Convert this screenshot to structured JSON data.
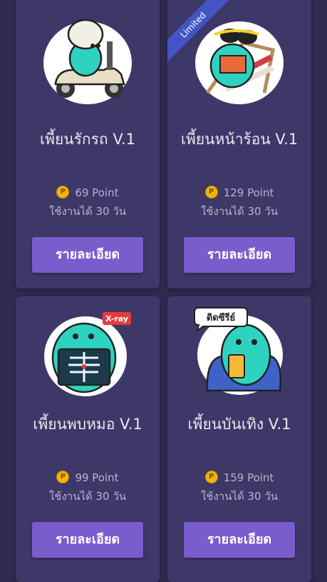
{
  "cards": [
    {
      "name": "เพี้ยนรักรถ V.1",
      "price": "69 Point",
      "duration": "ใช้งานได้ 30 วัน",
      "button_label": "รายละเอียด",
      "sticker_icon": "scooter-dino-sticker-icon"
    },
    {
      "name": "เพี้ยนหน้าร้อน V.1",
      "price": "129 Point",
      "duration": "ใช้งานได้ 30 วัน",
      "button_label": "รายละเอียด",
      "badge": "Limited",
      "sticker_icon": "beach-chair-dino-sticker-icon"
    },
    {
      "name": "เพี้ยนพบหมอ V.1",
      "price": "99 Point",
      "duration": "ใช้งานได้ 30 วัน",
      "button_label": "รายละเอียด",
      "sticker_label": "X-ray",
      "sticker_icon": "xray-dino-sticker-icon"
    },
    {
      "name": "เพี้ยนบันเทิง V.1",
      "price": "159 Point",
      "duration": "ใช้งานได้ 30 วัน",
      "button_label": "รายละเอียด",
      "sticker_label": "ติดซีรีย์",
      "sticker_icon": "phone-dino-sticker-icon"
    }
  ],
  "coin_symbol": "P",
  "colors": {
    "background": "#2f2a50",
    "card": "#3d3867",
    "button": "#7a5ccc",
    "coin": "#f2b400",
    "ribbon": "#4355c4",
    "dino": "#2ed3c0"
  }
}
